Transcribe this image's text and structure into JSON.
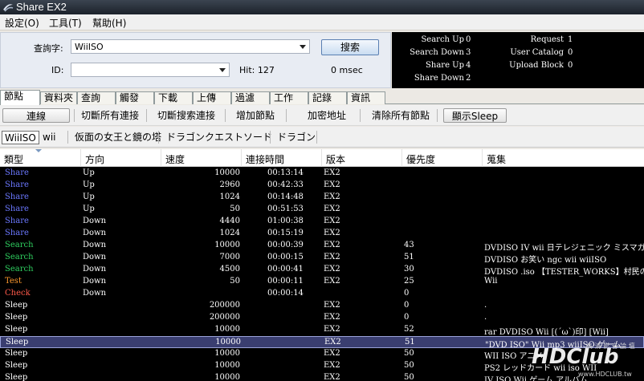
{
  "window": {
    "title": "Share EX2"
  },
  "menu": [
    "設定(O)",
    "工具(T)",
    "幫助(H)"
  ],
  "search": {
    "query_label": "查詢字:",
    "query_value": "WiiISO",
    "id_label": "ID:",
    "id_value": "",
    "hit_text": "Hit: 127",
    "msec_text": "0 msec",
    "search_button": "搜索"
  },
  "stats": [
    {
      "label": "Search Up",
      "value": "0"
    },
    {
      "label": "Search Down",
      "value": "3"
    },
    {
      "label": "Share Up",
      "value": "4"
    },
    {
      "label": "Share Down",
      "value": "2"
    },
    {
      "label": "Request",
      "value": "1"
    },
    {
      "label": "User Catalog",
      "value": "0"
    },
    {
      "label": "Upload Block",
      "value": "0"
    }
  ],
  "tabs": [
    "節點",
    "資料夾",
    "查詢",
    "觸發",
    "下載",
    "上傳",
    "過濾",
    "工作",
    "記錄",
    "資訊"
  ],
  "active_tab": "節點",
  "toolbar": [
    "連線",
    "切斷所有連接",
    "切斷搜索連接",
    "增加節點",
    "加密地址",
    "清除所有節點",
    "顯示Sleep"
  ],
  "keywords": [
    "WiiISO",
    "wii",
    "仮面の女王と鏡の塔",
    "ドラゴンクエストソード",
    "ドラゴン"
  ],
  "columns": [
    "類型",
    "方向",
    "速度",
    "連接時間",
    "版本",
    "優先度",
    "蒐集"
  ],
  "type_colors": {
    "Share": "#6b78ff",
    "Search": "#2fd160",
    "Test": "#ff9a2e",
    "Check": "#ff5a4a",
    "Sleep": "#ffffff"
  },
  "rows": [
    {
      "type": "Share",
      "dir": "Up",
      "speed": "10000",
      "time": "00:13:14",
      "ver": "EX2",
      "pri": "",
      "coll": ""
    },
    {
      "type": "Share",
      "dir": "Up",
      "speed": "2960",
      "time": "00:42:33",
      "ver": "EX2",
      "pri": "",
      "coll": ""
    },
    {
      "type": "Share",
      "dir": "Up",
      "speed": "1024",
      "time": "00:14:48",
      "ver": "EX2",
      "pri": "",
      "coll": ""
    },
    {
      "type": "Share",
      "dir": "Up",
      "speed": "50",
      "time": "00:51:53",
      "ver": "EX2",
      "pri": "",
      "coll": ""
    },
    {
      "type": "Share",
      "dir": "Down",
      "speed": "4440",
      "time": "01:00:38",
      "ver": "EX2",
      "pri": "",
      "coll": ""
    },
    {
      "type": "Share",
      "dir": "Down",
      "speed": "1024",
      "time": "00:15:19",
      "ver": "EX2",
      "pri": "",
      "coll": ""
    },
    {
      "type": "Search",
      "dir": "Down",
      "speed": "10000",
      "time": "00:00:39",
      "ver": "EX2",
      "pri": "43",
      "coll": "DVDISO IV wii 日テレジェニック ミスマガ"
    },
    {
      "type": "Search",
      "dir": "Down",
      "speed": "7000",
      "time": "00:00:15",
      "ver": "EX2",
      "pri": "51",
      "coll": "DVDISO お笑い ngc wii wiiISO"
    },
    {
      "type": "Search",
      "dir": "Down",
      "speed": "4500",
      "time": "00:00:41",
      "ver": "EX2",
      "pri": "30",
      "coll": "DVDISO .iso 【TESTER_WORKS】村民の村"
    },
    {
      "type": "Test",
      "dir": "Down",
      "speed": "50",
      "time": "00:00:11",
      "ver": "EX2",
      "pri": "25",
      "coll": "Wii"
    },
    {
      "type": "Check",
      "dir": "Down",
      "speed": "",
      "time": "00:00:14",
      "ver": "",
      "pri": "0",
      "coll": ""
    },
    {
      "type": "Sleep",
      "dir": "",
      "speed": "200000",
      "time": "",
      "ver": "EX2",
      "pri": "0",
      "coll": "."
    },
    {
      "type": "Sleep",
      "dir": "",
      "speed": "200000",
      "time": "",
      "ver": "EX2",
      "pri": "0",
      "coll": "."
    },
    {
      "type": "Sleep",
      "dir": "",
      "speed": "10000",
      "time": "",
      "ver": "EX2",
      "pri": "52",
      "coll": "rar DVDISO Wii [(´ω`)印] [Wii]"
    },
    {
      "type": "Sleep",
      "dir": "",
      "speed": "10000",
      "time": "",
      "ver": "EX2",
      "pri": "51",
      "coll": "\"DVD ISO\" Wii mp3 wiiISO ゲーム"
    },
    {
      "type": "Sleep",
      "dir": "",
      "speed": "10000",
      "time": "",
      "ver": "EX2",
      "pri": "50",
      "coll": "WII ISO アニメ"
    },
    {
      "type": "Sleep",
      "dir": "",
      "speed": "10000",
      "time": "",
      "ver": "EX2",
      "pri": "50",
      "coll": "PS2 レッドカード wii iso WII"
    },
    {
      "type": "Sleep",
      "dir": "",
      "speed": "10000",
      "time": "",
      "ver": "EX2",
      "pri": "50",
      "coll": "IV ISO Wii ゲーム アルバム"
    }
  ],
  "selected_row": 14,
  "watermark": {
    "brand": "HDClub",
    "cn": "高 清 影 音 論 壇",
    "url": "www.HDCLUB.tw"
  }
}
